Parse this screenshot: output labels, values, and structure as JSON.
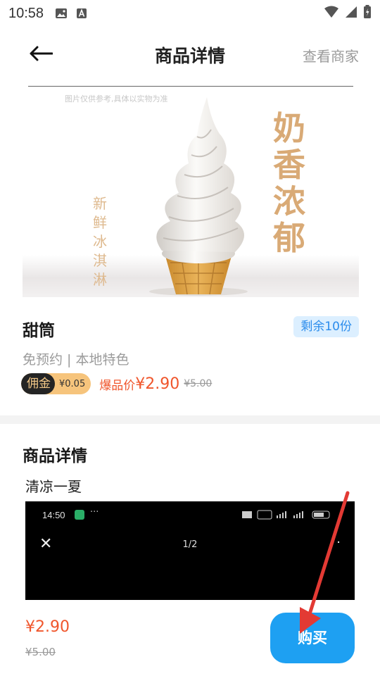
{
  "status_bar": {
    "time": "10:58",
    "icons_left": [
      "image-icon",
      "a-badge-icon"
    ],
    "icons_right": [
      "wifi-icon",
      "signal-icon",
      "battery-icon"
    ]
  },
  "header": {
    "back_icon": "back-arrow-icon",
    "title": "商品详情",
    "merchant_link": "查看商家"
  },
  "hero": {
    "note": "图片仅供参考,具体以实物为准",
    "slogan_right": "奶香浓郁",
    "slogan_left": "新鲜冰淇淋"
  },
  "product": {
    "name": "甜筒",
    "stock": "剩余10份",
    "tags": "免预约 | 本地特色",
    "commission_label": "佣金",
    "commission_value": "¥0.05",
    "hot_label": "爆品价",
    "hot_price": "¥2.90",
    "original_price": "¥5.00"
  },
  "details": {
    "title": "商品详情",
    "text": "清凉一夏",
    "embedded_screenshot": {
      "time": "14:50",
      "page": "1/2",
      "dots": "···",
      "more": "··"
    }
  },
  "bottom_bar": {
    "price": "¥2.90",
    "original_price": "¥5.00",
    "buy_label": "购买"
  },
  "colors": {
    "accent_blue": "#1ea0f2",
    "price_red": "#f0562c",
    "slogan_gold": "#d9aa76",
    "arrow_red": "#e33a34"
  }
}
